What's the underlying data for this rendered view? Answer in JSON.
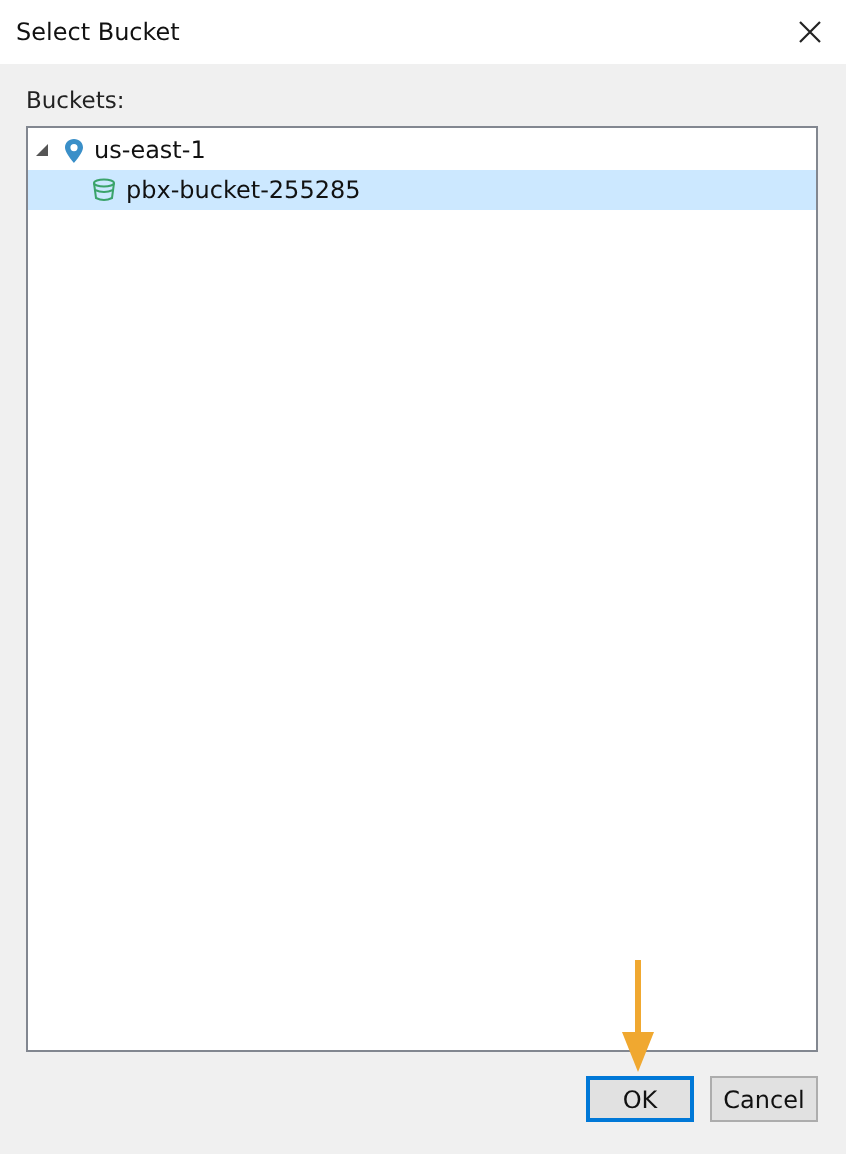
{
  "window": {
    "title": "Select Bucket"
  },
  "tree_label": "Buckets:",
  "tree": [
    {
      "kind": "region",
      "label": "us-east-1",
      "expanded": true,
      "selected": false,
      "children": [
        {
          "kind": "bucket",
          "label": "pbx-bucket-255285",
          "selected": true
        }
      ]
    }
  ],
  "buttons": [
    {
      "label": "OK",
      "default": true
    },
    {
      "label": "Cancel",
      "default": false
    }
  ]
}
